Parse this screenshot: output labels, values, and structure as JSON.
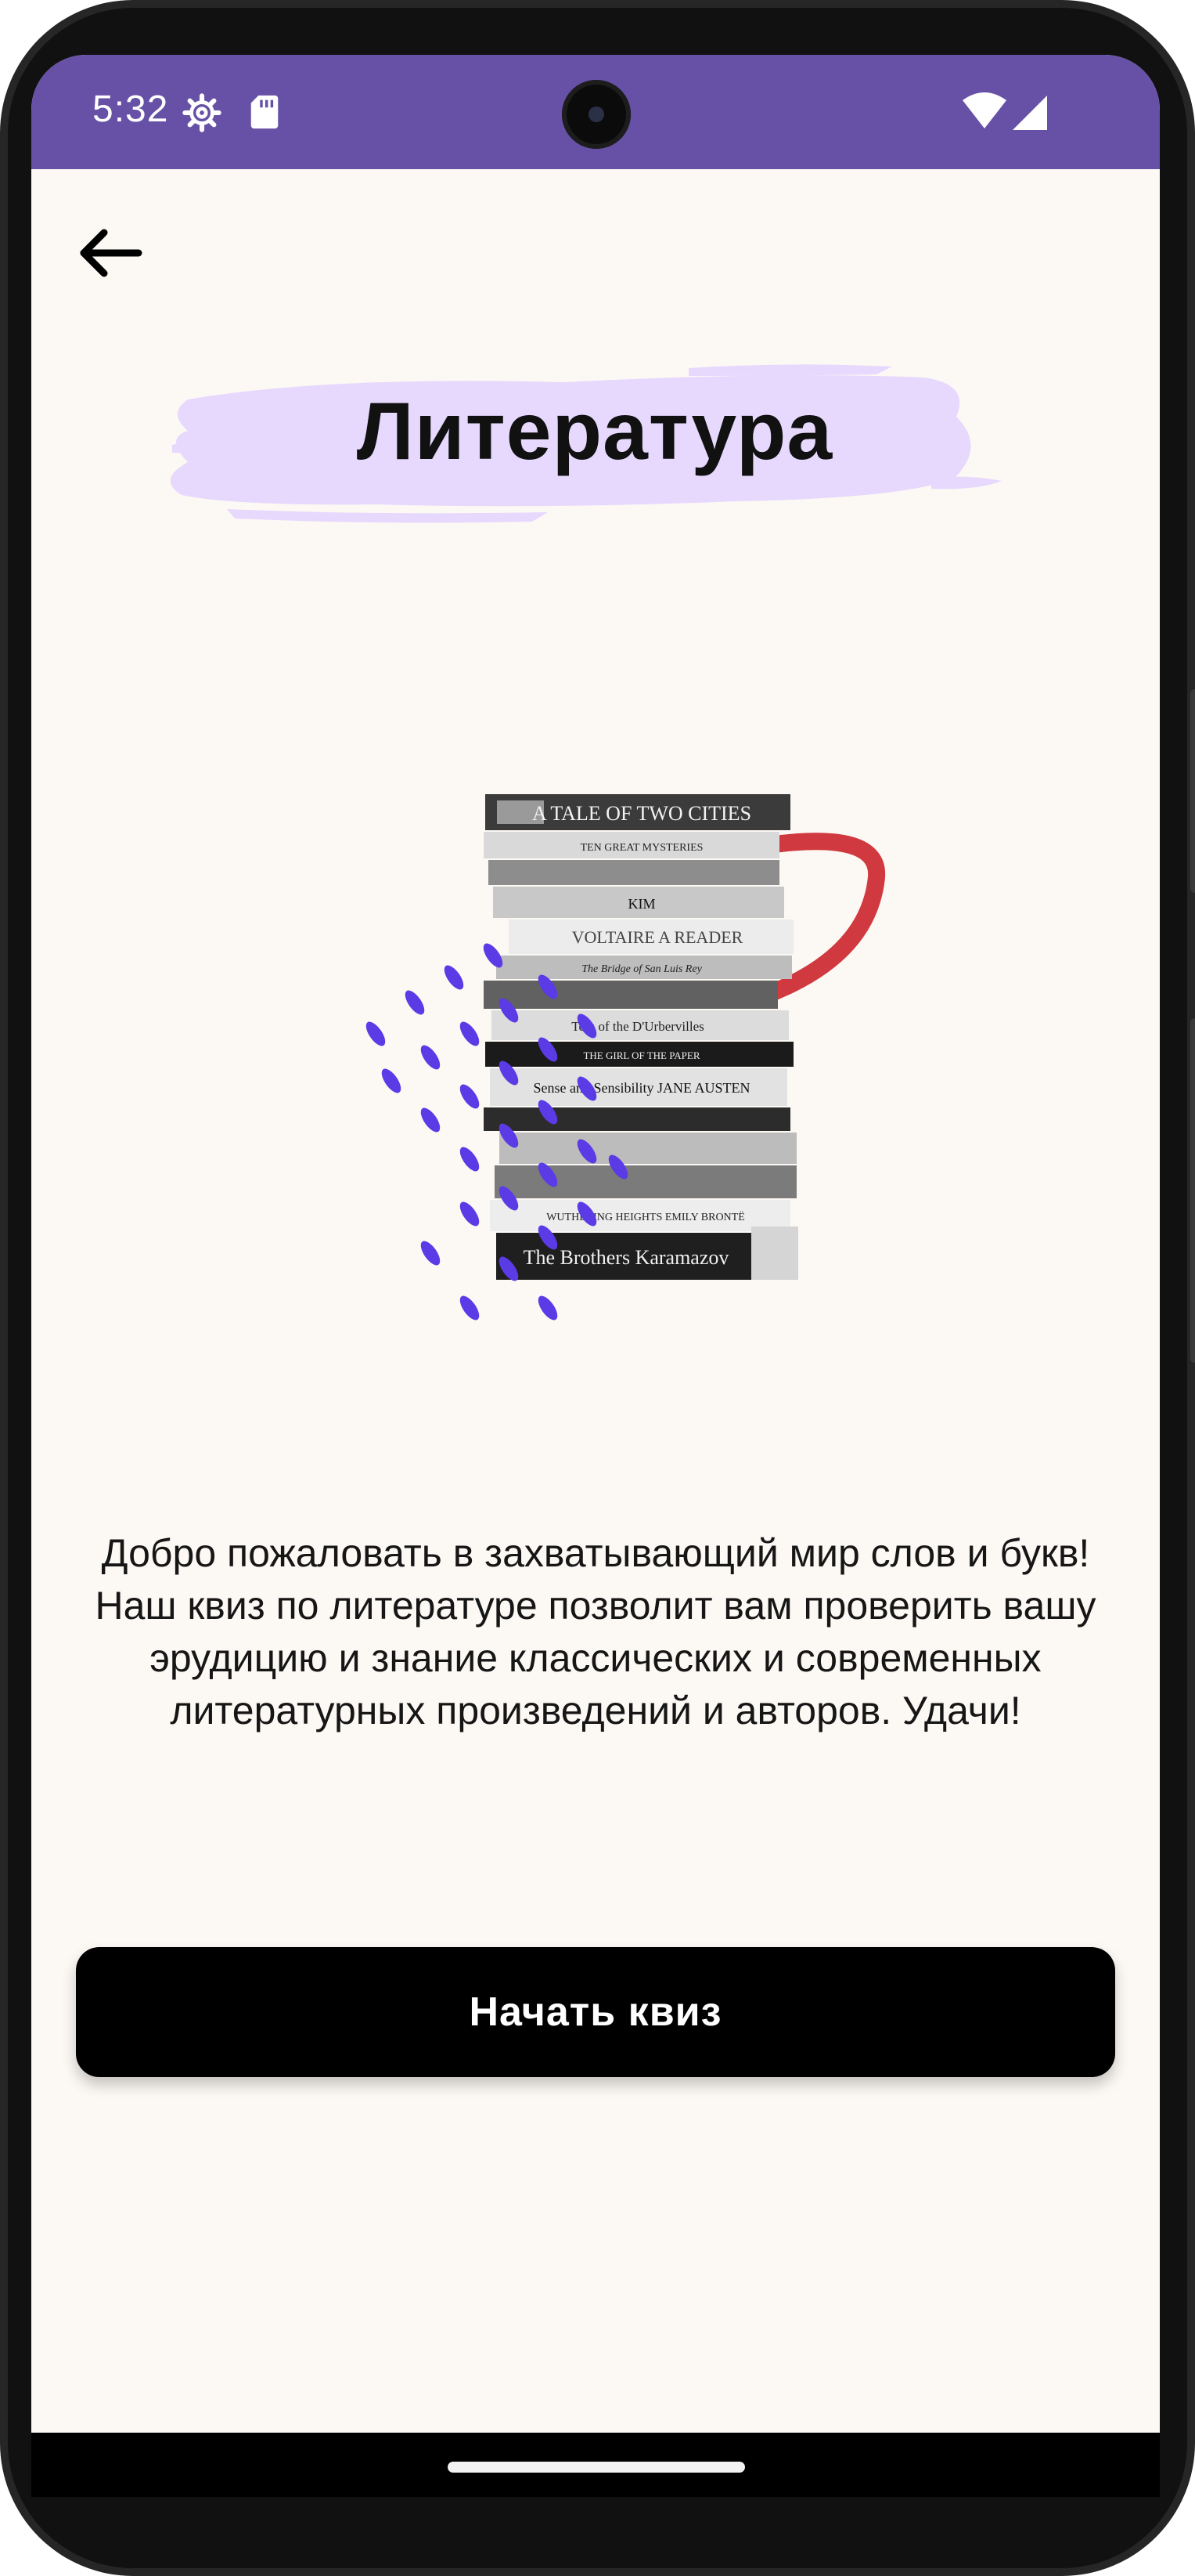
{
  "status_bar": {
    "time": "5:32",
    "icons_left": [
      "settings-icon",
      "sd-card-icon"
    ],
    "icons_right": [
      "wifi-icon",
      "cell-signal-icon"
    ],
    "color": "#6751a6"
  },
  "header": {
    "back_icon": "arrow-left-icon",
    "title": "Литература",
    "title_highlight_color": "#e6d9fd"
  },
  "illustration": {
    "book_spines": [
      "A TALE OF TWO CITIES",
      "TEN GREAT MYSTERIES",
      "KIM",
      "VOLTAIRE  A READER",
      "The Bridge of San Luis Rey",
      "Tess of the D'Urbervilles",
      "THE GIRL OF THE PAPER",
      "Sense and Sensibility  JANE AUSTEN",
      "WUTHERING HEIGHTS  EMILY BRONTË",
      "The Brothers Karamazov"
    ],
    "accent_color": "#5a3be6",
    "mug_handle_color": "#d0393f"
  },
  "description": {
    "text": "Добро пожаловать в захватывающий мир слов и букв! Наш квиз по литературе позволит вам проверить вашу эрудицию и знание классических и современных литературных произведений и авторов. Удачи!"
  },
  "actions": {
    "start_label": "Начать квиз"
  },
  "colors": {
    "background": "#fcf8f4",
    "button": "#000000",
    "button_text": "#ffffff"
  }
}
